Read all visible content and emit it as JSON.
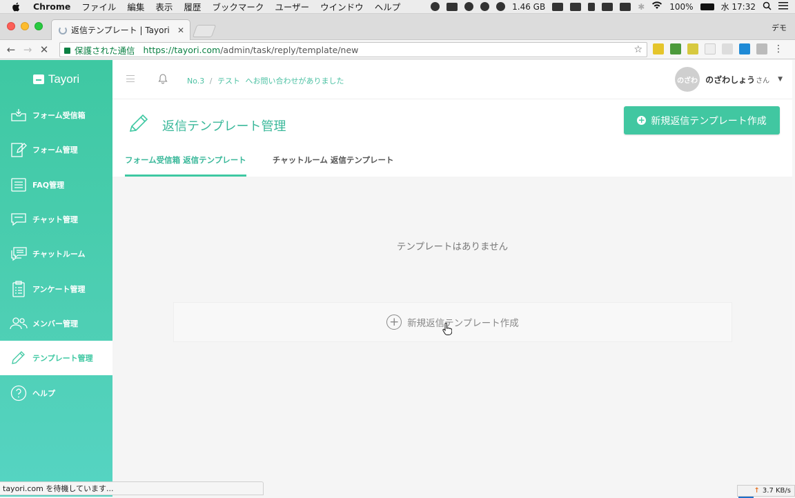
{
  "menubar": {
    "app": "Chrome",
    "items": [
      "ファイル",
      "編集",
      "表示",
      "履歴",
      "ブックマーク",
      "ユーザー",
      "ウインドウ",
      "ヘルプ"
    ],
    "memory": "1.46 GB",
    "battery": "100%",
    "clock": "水 17:32"
  },
  "browser": {
    "tab_title": "返信テンプレート | Tayori",
    "profile": "デモ",
    "secure_label": "保護された通信",
    "url_host": "https://tayori.com",
    "url_path": "/admin/task/reply/template/new",
    "status_text": "tayori.com を待機しています...",
    "net_speed": "3.7 KB/s"
  },
  "sidebar": {
    "logo": "Tayori",
    "items": [
      {
        "label": "フォーム受信箱",
        "icon": "inbox-icon"
      },
      {
        "label": "フォーム管理",
        "icon": "form-edit-icon"
      },
      {
        "label": "FAQ管理",
        "icon": "faq-list-icon"
      },
      {
        "label": "チャット管理",
        "icon": "chat-bubble-icon"
      },
      {
        "label": "チャットルーム",
        "icon": "chat-room-icon"
      },
      {
        "label": "アンケート管理",
        "icon": "survey-clipboard-icon"
      },
      {
        "label": "メンバー管理",
        "icon": "members-icon"
      },
      {
        "label": "テンプレート管理",
        "icon": "pencil-icon"
      },
      {
        "label": "ヘルプ",
        "icon": "help-icon"
      }
    ]
  },
  "topbar": {
    "breadcrumb_no": "No.3",
    "breadcrumb_sep": "/",
    "breadcrumb_form": "テスト",
    "breadcrumb_text": "へお問い合わせがありました",
    "avatar_text": "のざわ",
    "user_name": "のざわしょう",
    "user_suffix": "さん"
  },
  "header": {
    "title": "返信テンプレート管理",
    "create_button": "新規返信テンプレート作成",
    "tabs": [
      "フォーム受信箱 返信テンプレート",
      "チャットルーム 返信テンプレート"
    ]
  },
  "content": {
    "empty_message": "テンプレートはありません",
    "create_label": "新規返信テンプレート作成"
  },
  "colors": {
    "brand": "#3ec8a2",
    "sidebar_bottom": "#56d4c3"
  }
}
